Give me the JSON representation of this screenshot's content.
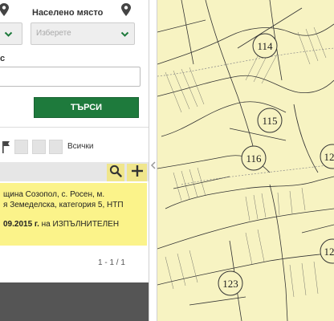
{
  "filters": {
    "settlement_label": "Населено място",
    "settlement_placeholder": "Изберете",
    "field_label_partial": "с"
  },
  "search": {
    "button_label": "ТЪРСИ"
  },
  "tools": {
    "all_label": "Всички"
  },
  "result": {
    "line1": "щина Созопол, с. Росен, м.",
    "line2": "я Земеделска, категория 5, НТП",
    "status_date": "09.2015 г.",
    "status_suffix": " на ИЗПЪЛНИТЕЛЕН"
  },
  "pagination": {
    "text": "1 - 1 / 1"
  },
  "map": {
    "parcels": [
      "114",
      "115",
      "116",
      "12",
      "123",
      "12"
    ]
  },
  "colors": {
    "accent": "#1e7a3c",
    "highlight": "#fbf38a",
    "map_bg": "#f7f3c2"
  }
}
